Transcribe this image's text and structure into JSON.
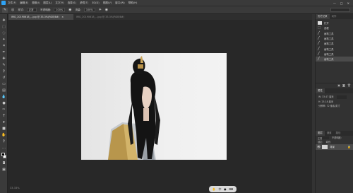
{
  "menubar": {
    "items": [
      "文件(F)",
      "编辑(E)",
      "图像(I)",
      "图层(L)",
      "文字(Y)",
      "选择(S)",
      "滤镜(T)",
      "3D(D)",
      "视图(V)",
      "窗口(W)",
      "帮助(H)"
    ],
    "window_controls": [
      "—",
      "□",
      "✕"
    ]
  },
  "options": {
    "feather_label": "羽化:",
    "feather_value": "0 像素",
    "style_label": "样式:",
    "style_value": "正常",
    "width_label": "宽度:",
    "height_label": "高度:",
    "opacity_label": "不透明度:",
    "opacity_value": "100%",
    "flow_label": "流量:",
    "flow_value": "100%"
  },
  "tabs": {
    "active": "IMG_20190618_...jpg @ 33.3%(RGB/8#)",
    "active_close": "×",
    "inactive": "IMG_20190618_...jpg @ 33.3%(RGB/8#)"
  },
  "history": {
    "tab_active": "历史记录",
    "tab_inactive": "动作",
    "rows": [
      {
        "label": "打开",
        "kind": "thumb"
      },
      {
        "label": "选框",
        "kind": "thumb"
      },
      {
        "label": "画笔工具",
        "kind": "brush"
      },
      {
        "label": "画笔工具",
        "kind": "brush"
      },
      {
        "label": "画笔工具",
        "kind": "brush"
      },
      {
        "label": "画笔工具",
        "kind": "brush"
      },
      {
        "label": "画笔工具",
        "kind": "brush"
      },
      {
        "label": "画笔工具",
        "kind": "brush"
      }
    ]
  },
  "properties": {
    "title": "属性",
    "w_label": "W:",
    "w_value": "33.47 厘米",
    "h_label": "H:",
    "h_value": "25.18 厘米",
    "res_label": "分辨率:",
    "res_value": "72 像素/英寸"
  },
  "layers": {
    "tabs": [
      "图层",
      "通道",
      "路径"
    ],
    "mode_label": "正常",
    "opacity_label": "不透明度:",
    "lock_label": "锁定:",
    "fill_label": "填充:",
    "row_label": "背景"
  },
  "status": {
    "zoom": "33.33%",
    "pill_items": [
      "✋",
      "中",
      "●",
      "⌨"
    ]
  },
  "colors": {
    "accent": "#2fa3f5",
    "panel_bg": "#323232",
    "canvas_bg": "#282828"
  }
}
